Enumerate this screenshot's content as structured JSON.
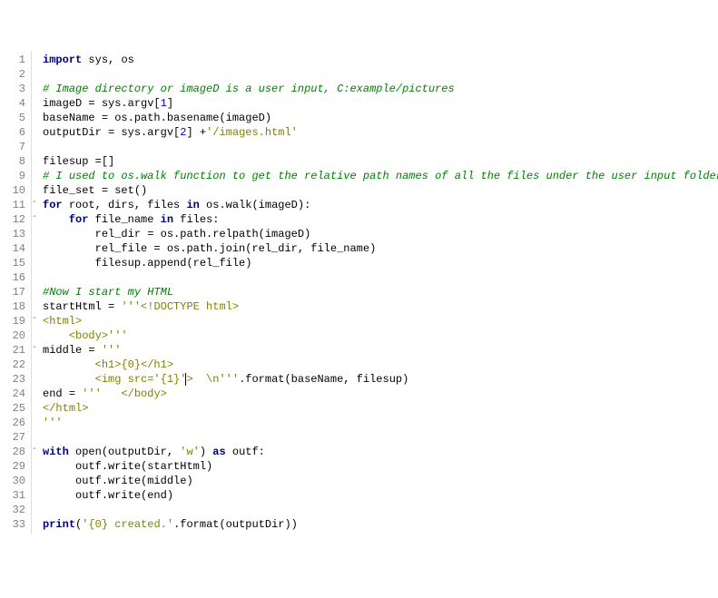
{
  "lines": [
    {
      "n": 1,
      "fold": "",
      "tokens": [
        {
          "c": "kw",
          "t": "import"
        },
        {
          "c": "id",
          "t": " sys, os"
        }
      ]
    },
    {
      "n": 2,
      "fold": "",
      "tokens": []
    },
    {
      "n": 3,
      "fold": "",
      "tokens": [
        {
          "c": "cm",
          "t": "# Image directory or imageD is a user input, C:example/pictures"
        }
      ]
    },
    {
      "n": 4,
      "fold": "",
      "tokens": [
        {
          "c": "id",
          "t": "imageD = sys.argv["
        },
        {
          "c": "nm",
          "t": "1"
        },
        {
          "c": "id",
          "t": "]"
        }
      ]
    },
    {
      "n": 5,
      "fold": "",
      "tokens": [
        {
          "c": "id",
          "t": "baseName = os.path.basename(imageD)"
        }
      ]
    },
    {
      "n": 6,
      "fold": "",
      "tokens": [
        {
          "c": "id",
          "t": "outputDir = sys.argv["
        },
        {
          "c": "nm",
          "t": "2"
        },
        {
          "c": "id",
          "t": "] +"
        },
        {
          "c": "st",
          "t": "'/images.html'"
        }
      ]
    },
    {
      "n": 7,
      "fold": "",
      "tokens": []
    },
    {
      "n": 8,
      "fold": "",
      "tokens": [
        {
          "c": "id",
          "t": "filesup =[]"
        }
      ]
    },
    {
      "n": 9,
      "fold": "",
      "tokens": [
        {
          "c": "cm",
          "t": "# I used to os.walk function to get the relative path names of all the files under the user input folder,"
        }
      ]
    },
    {
      "n": 10,
      "fold": "",
      "tokens": [
        {
          "c": "id",
          "t": "file_set = set()"
        }
      ]
    },
    {
      "n": 11,
      "fold": "-",
      "tokens": [
        {
          "c": "kw",
          "t": "for"
        },
        {
          "c": "id",
          "t": " root, dirs, files "
        },
        {
          "c": "kw",
          "t": "in"
        },
        {
          "c": "id",
          "t": " os.walk(imageD):"
        }
      ]
    },
    {
      "n": 12,
      "fold": "-",
      "tokens": [
        {
          "c": "id",
          "t": "    "
        },
        {
          "c": "kw",
          "t": "for"
        },
        {
          "c": "id",
          "t": " file_name "
        },
        {
          "c": "kw",
          "t": "in"
        },
        {
          "c": "id",
          "t": " files:"
        }
      ]
    },
    {
      "n": 13,
      "fold": "",
      "tokens": [
        {
          "c": "id",
          "t": "        rel_dir = os.path.relpath(imageD)"
        }
      ]
    },
    {
      "n": 14,
      "fold": "",
      "tokens": [
        {
          "c": "id",
          "t": "        rel_file = os.path.join(rel_dir, file_name)"
        }
      ]
    },
    {
      "n": 15,
      "fold": "",
      "tokens": [
        {
          "c": "id",
          "t": "        filesup.append(rel_file)"
        }
      ]
    },
    {
      "n": 16,
      "fold": "",
      "tokens": []
    },
    {
      "n": 17,
      "fold": "",
      "tokens": [
        {
          "c": "cm",
          "t": "#Now I start my HTML"
        }
      ]
    },
    {
      "n": 18,
      "fold": "",
      "tokens": [
        {
          "c": "id",
          "t": "startHtml = "
        },
        {
          "c": "st",
          "t": "'''<!DOCTYPE html>"
        }
      ]
    },
    {
      "n": 19,
      "fold": "-",
      "tokens": [
        {
          "c": "st",
          "t": "<html>"
        }
      ]
    },
    {
      "n": 20,
      "fold": "",
      "tokens": [
        {
          "c": "st",
          "t": "    <body>'''"
        }
      ]
    },
    {
      "n": 21,
      "fold": "-",
      "tokens": [
        {
          "c": "id",
          "t": "middle = "
        },
        {
          "c": "st",
          "t": "'''"
        }
      ]
    },
    {
      "n": 22,
      "fold": "",
      "tokens": [
        {
          "c": "st",
          "t": "        <h1>{0}</h1>"
        }
      ]
    },
    {
      "n": 23,
      "fold": "",
      "tokens": [
        {
          "c": "st",
          "t": "        <img src='{1}'"
        },
        {
          "c": "cursor",
          "t": ""
        },
        {
          "c": "st",
          "t": ">  \\n'''"
        },
        {
          "c": "id",
          "t": ".format(baseName, filesup)"
        }
      ]
    },
    {
      "n": 24,
      "fold": "",
      "tokens": [
        {
          "c": "id",
          "t": "end = "
        },
        {
          "c": "st",
          "t": "'''   </body>"
        }
      ]
    },
    {
      "n": 25,
      "fold": "",
      "tokens": [
        {
          "c": "st",
          "t": "</html>"
        }
      ]
    },
    {
      "n": 26,
      "fold": "",
      "tokens": [
        {
          "c": "st",
          "t": "'''"
        }
      ]
    },
    {
      "n": 27,
      "fold": "",
      "tokens": []
    },
    {
      "n": 28,
      "fold": "-",
      "tokens": [
        {
          "c": "kw",
          "t": "with"
        },
        {
          "c": "id",
          "t": " open(outputDir, "
        },
        {
          "c": "st",
          "t": "'w'"
        },
        {
          "c": "id",
          "t": ") "
        },
        {
          "c": "kw",
          "t": "as"
        },
        {
          "c": "id",
          "t": " outf:"
        }
      ]
    },
    {
      "n": 29,
      "fold": "",
      "tokens": [
        {
          "c": "id",
          "t": "     outf.write(startHtml)"
        }
      ]
    },
    {
      "n": 30,
      "fold": "",
      "tokens": [
        {
          "c": "id",
          "t": "     outf.write(middle)"
        }
      ]
    },
    {
      "n": 31,
      "fold": "",
      "tokens": [
        {
          "c": "id",
          "t": "     outf.write(end)"
        }
      ]
    },
    {
      "n": 32,
      "fold": "",
      "tokens": []
    },
    {
      "n": 33,
      "fold": "",
      "tokens": [
        {
          "c": "kw",
          "t": "print"
        },
        {
          "c": "id",
          "t": "("
        },
        {
          "c": "st",
          "t": "'{0} created.'"
        },
        {
          "c": "id",
          "t": ".format(outputDir))"
        }
      ]
    }
  ]
}
